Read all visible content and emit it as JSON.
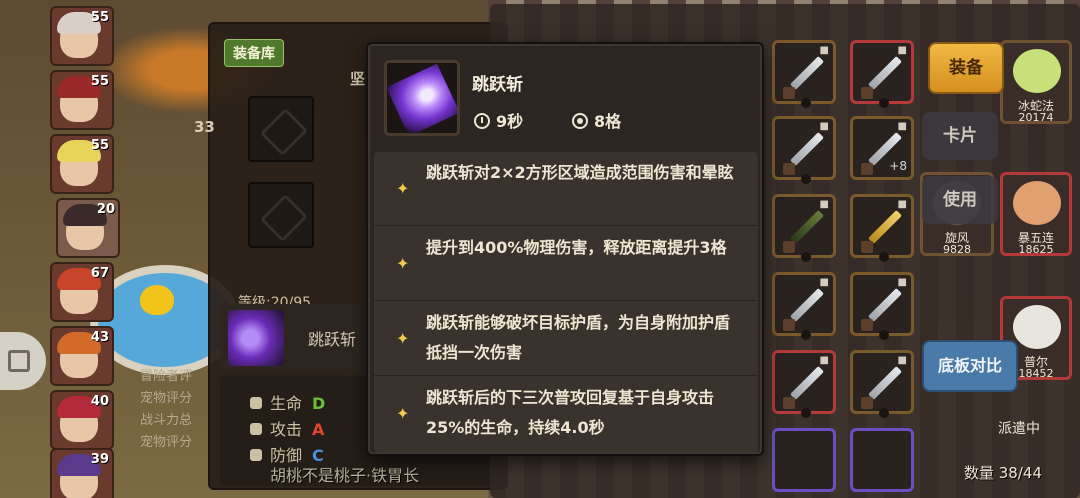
{
  "roster": {
    "levels": [
      "55",
      "55",
      "55",
      "20",
      "67",
      "43",
      "40",
      "39"
    ]
  },
  "equipment_panel": {
    "tab_label": "装备库",
    "level_text": "等级:20/95",
    "skill_name": "跳跃斩",
    "stats": [
      {
        "label": "生命",
        "grade": "D",
        "color": "#6bbf3a"
      },
      {
        "label": "攻击",
        "grade": "A",
        "color": "#e0462d"
      },
      {
        "label": "防御",
        "grade": "C",
        "color": "#4b8fe0"
      }
    ],
    "pet_lines": [
      "冒险者评",
      "宠物评分",
      "战斗力总",
      "宠物评分"
    ],
    "fragment_power": "33",
    "fragment_char": "坚",
    "bottom_text": "胡桃不是桃子·铁胃长"
  },
  "tooltip": {
    "skill_name": "跳跃斩",
    "cooldown": "9秒",
    "range": "8格",
    "effects": [
      "跳跃斩对2×2方形区域造成范围伤害和晕眩",
      "提升到400%物理伤害，释放距离提升3格",
      "跳跃斩能够破坏目标护盾，为自身附加护盾抵挡一次伤害",
      "跳跃斩后的下三次普攻回复基于自身攻击25%的生命，持续4.0秒"
    ]
  },
  "inventory": {
    "plus_tag": "+8"
  },
  "buttons": {
    "equip": "装备",
    "card": "卡片",
    "use": "使用",
    "compare": "底板对比"
  },
  "heroes": [
    {
      "name": "冰蛇法",
      "power": "20174"
    },
    {
      "name": "旋风",
      "power": "9828"
    },
    {
      "name": "暴五连",
      "power": "18625"
    },
    {
      "name": "普尔",
      "power": "18452"
    }
  ],
  "dispatch_label": "派遣中",
  "count_label": "数量 38/44"
}
